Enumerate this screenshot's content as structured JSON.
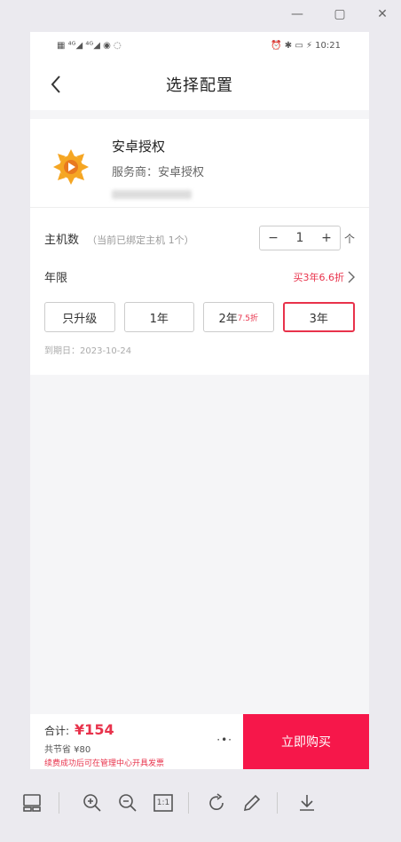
{
  "window": {
    "minimize": "—",
    "maximize": "▢",
    "close": "✕"
  },
  "statusbar": {
    "left": "▦ ⁴ᴳ◢ ⁴ᴳ◢ ◉ ◌",
    "right": "⏰ ✱ ▭ ⚡ 10:21"
  },
  "nav": {
    "title": "选择配置"
  },
  "product": {
    "name": "安卓授权",
    "vendor": "服务商：安卓授权"
  },
  "quantity": {
    "label": "主机数",
    "sub": "（当前已绑定主机 1个）",
    "value": "1",
    "unit": "个",
    "minus": "−",
    "plus": "+"
  },
  "period": {
    "label": "年限",
    "promo": "买3年6.6折",
    "options": [
      {
        "label": "只升级",
        "tag": ""
      },
      {
        "label": "1年",
        "tag": ""
      },
      {
        "label": "2年",
        "tag": "7.5折"
      },
      {
        "label": "3年",
        "tag": ""
      }
    ],
    "selected": "3年",
    "expire": "到期日：2023-10-24"
  },
  "bottom": {
    "total_label": "合计:",
    "total": "¥154",
    "saved": "共节省 ¥80",
    "note": "续费成功后可在管理中心开具发票",
    "more": "·•·",
    "buy": "立即购买"
  },
  "colors": {
    "accent": "#e8324b",
    "buy_bg": "#f6174a",
    "icon": "#f5a623"
  },
  "toolbar_icons": [
    "thumbnail-icon",
    "zoom-in-icon",
    "zoom-out-icon",
    "actual-size-icon",
    "rotate-icon",
    "edit-icon",
    "download-icon"
  ],
  "toolbar": {
    "actual": "1:1"
  }
}
